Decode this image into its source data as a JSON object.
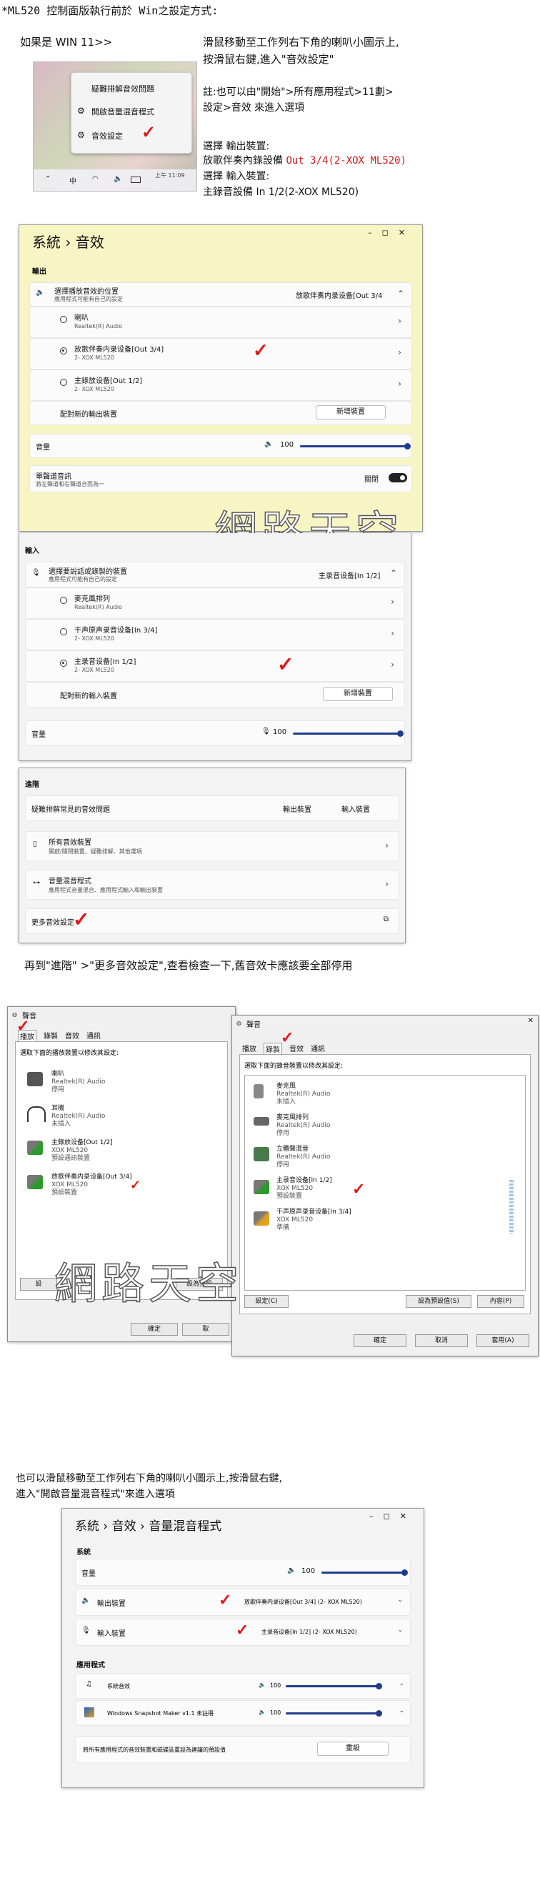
{
  "intro": {
    "title": "*ML520 控制面版執行前於 Win之設定方式:",
    "win11_label": "如果是 WIN 11>>",
    "instruction1": "滑鼠移動至工作列右下角的喇叭小圖示上,",
    "instruction2": "按滑鼠右鍵,進入\"音效設定\"",
    "note1": "註:也可以由\"開始\">所有應用程式>11劃>",
    "note2": "設定>音效 來進入選項",
    "output_label": "選擇 輸出裝置:",
    "output_value_prefix": "放歌伴奏內錄設備 ",
    "output_value_red": "Out 3/4(2-XOX ML520)",
    "input_label": "選擇 輸入裝置:",
    "input_value": "主錄音設備 In 1/2(2-XOX ML520)"
  },
  "context_menu": {
    "items": [
      "疑難排解音效問題",
      "開啟音量混音程式",
      "音效設定"
    ],
    "taskbar": {
      "ime": "中",
      "time": "上午 11:09"
    }
  },
  "settings_output": {
    "breadcrumb": "系統 › 音效",
    "section_output": "輸出",
    "choose_output": "選擇播放音效的位置",
    "choose_output_hint": "應用程式可能有自己的設定",
    "current_output": "放歌伴奏内录设备[Out 3/4",
    "devices": [
      {
        "name": "喇叭",
        "sub": "Realtek(R) Audio",
        "selected": false
      },
      {
        "name": "放歌伴奏内录设备[Out 3/4]",
        "sub": "2- XOX ML520",
        "selected": true
      },
      {
        "name": "主錄放设备[Out 1/2]",
        "sub": "2- XOX ML520",
        "selected": false
      }
    ],
    "pair_new": "配對新的輸出裝置",
    "add_device": "新增裝置",
    "volume_label": "音量",
    "volume_value": "100",
    "volume_fraction": 1.0,
    "mono_label": "單聲道音訊",
    "mono_hint": "將左聲道和右聲道合而為一",
    "mono_state": "關閉"
  },
  "settings_input": {
    "section_input": "輸入",
    "choose_input": "選擇要說話或錄製的裝置",
    "choose_input_hint": "應用程式可能有自己的設定",
    "current_input": "主录音设备[In 1/2]",
    "devices": [
      {
        "name": "麥克風排列",
        "sub": "Realtek(R) Audio",
        "selected": false
      },
      {
        "name": "干声原声录音设备[In 3/4]",
        "sub": "2- XOX ML520",
        "selected": false
      },
      {
        "name": "主录音设备[In 1/2]",
        "sub": "2- XOX ML520",
        "selected": true
      }
    ],
    "pair_new": "配對新的輸入裝置",
    "add_device": "新增裝置",
    "volume_label": "音量",
    "volume_value": "100",
    "volume_fraction": 1.0
  },
  "settings_advanced": {
    "section": "進階",
    "troubleshoot": "疑難排解常見的音效問題",
    "out_dev": "輸出裝置",
    "in_dev": "輸入裝置",
    "all_devices": "所有音效裝置",
    "all_devices_hint": "開啟/關閉裝置、疑難排解、其他選項",
    "mixer": "音量混音程式",
    "mixer_hint": "應用程式音量混合、應用程式輸入和輸出裝置",
    "more": "更多音效設定"
  },
  "mid_caption": "再到\"進階\" >\"更多音效設定\",查看檢查一下,舊音效卡應該要全部停用",
  "watermark": "網路天空",
  "sound_playback": {
    "title": "聲音",
    "tabs": [
      "播放",
      "錄製",
      "音效",
      "通訊"
    ],
    "instruction": "選取下面的播放裝置以修改其設定:",
    "devices": [
      {
        "name": "喇叭",
        "sub": "Realtek(R) Audio",
        "state": "停用"
      },
      {
        "name": "耳機",
        "sub": "Realtek(R) Audio",
        "state": "未插入"
      },
      {
        "name": "主錄放设备[Out 1/2]",
        "sub": "XOX ML520",
        "state": "預設通訊裝置"
      },
      {
        "name": "放歌伴奏内录设备[Out 3/4]",
        "sub": "XOX ML520",
        "state": "預設裝置"
      }
    ],
    "configure": "設",
    "set_default": "設為預設",
    "ok": "確定",
    "cancel": "取"
  },
  "sound_recording": {
    "title": "聲音",
    "tabs": [
      "播放",
      "錄製",
      "音效",
      "通訊"
    ],
    "instruction": "選取下面的錄音裝置以修改其設定:",
    "devices": [
      {
        "name": "麥克風",
        "sub": "Realtek(R) Audio",
        "state": "未插入"
      },
      {
        "name": "麥克風排列",
        "sub": "Realtek(R) Audio",
        "state": "停用"
      },
      {
        "name": "立體聲混音",
        "sub": "Realtek(R) Audio",
        "state": "停用"
      },
      {
        "name": "主录音设备[In 1/2]",
        "sub": "XOX ML520",
        "state": "預設裝置"
      },
      {
        "name": "干声原声录音设备[In 3/4]",
        "sub": "XOX ML520",
        "state": "準備"
      }
    ],
    "configure": "設定(C)",
    "set_default": "設為預設值(S)",
    "properties": "內容(P)",
    "ok": "確定",
    "cancel": "取消",
    "apply": "套用(A)"
  },
  "bottom_caption1": "也可以滑鼠移動至工作列右下角的喇叭小圖示上,按滑鼠右鍵,",
  "bottom_caption2": "進入\"開啟音量混音程式\"來進入選項",
  "mixer": {
    "breadcrumb": "系統 › 音效 › 音量混音程式",
    "system_section": "系統",
    "volume_label": "音量",
    "volume_value": "100",
    "output_label": "輸出裝置",
    "output_value": "放歌伴奏内录设备[Out 3/4] (2- XOX ML520)",
    "input_label": "輸入裝置",
    "input_value": "主录音设备[In 1/2] (2- XOX ML520)",
    "apps_section": "應用程式",
    "apps": [
      {
        "name": "系統音效",
        "value": "100"
      },
      {
        "name": "Windows Snapshot Maker v1.1 未註冊",
        "value": "100"
      }
    ],
    "reset_text": "將所有應用程式的音效裝置和磁碟區重設為建議的預設值",
    "reset_button": "重設"
  },
  "colors": {
    "accent": "#1f3c8c",
    "check": "#e01818",
    "highlight": "#f7f5c4",
    "red_text": "#d01818"
  }
}
